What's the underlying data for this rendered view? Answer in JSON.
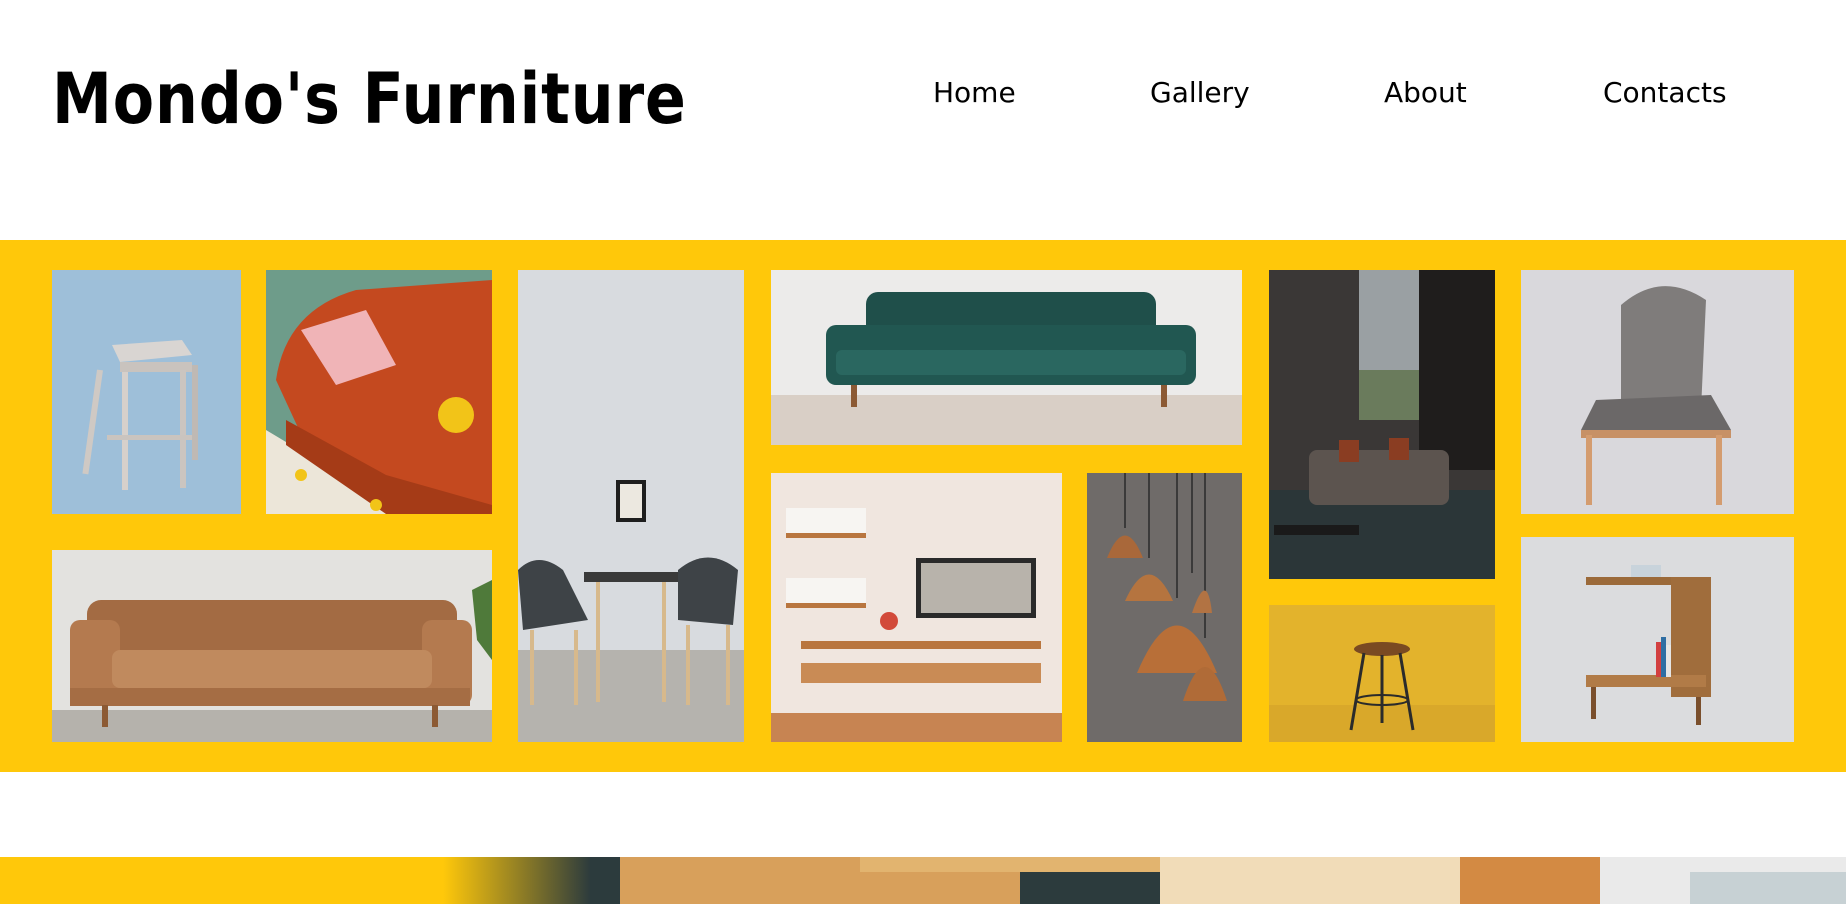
{
  "header": {
    "logo": "Mondo's Furniture",
    "nav": [
      "Home",
      "Gallery",
      "About",
      "Contacts"
    ]
  },
  "colors": {
    "accent": "#ffc80a",
    "background": "#ffffff",
    "text": "#000000"
  },
  "gallery": {
    "photos": [
      "stool-photo",
      "orange-sofa-photo",
      "dining-set-photo",
      "green-sofa-photo",
      "living-room-photo",
      "gray-chair-photo",
      "leather-sofa-photo",
      "wall-shelves-photo",
      "pendant-lamps-photo",
      "bar-stool-photo",
      "side-table-photo"
    ]
  }
}
